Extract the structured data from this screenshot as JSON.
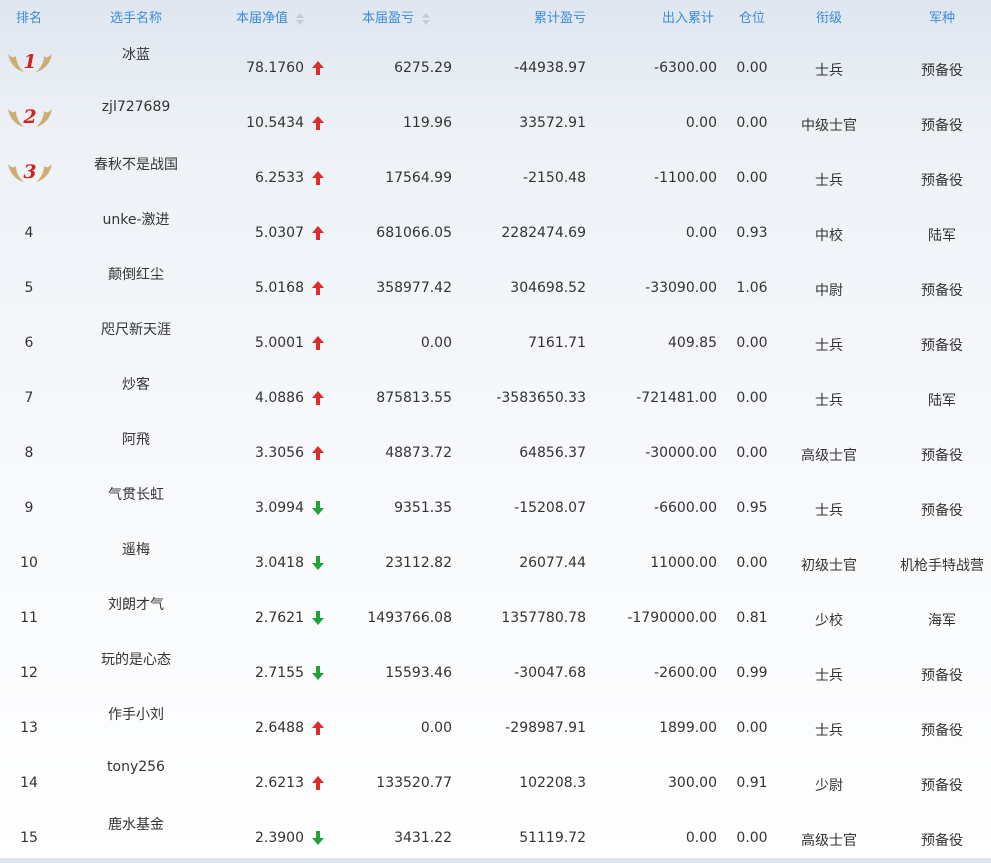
{
  "header": {
    "rank": "排名",
    "name": "选手名称",
    "nav": "本届净值",
    "profit": "本届盈亏",
    "cumulative": "累计盈亏",
    "flow": "出入累计",
    "position": "仓位",
    "grade": "衔级",
    "branch": "军种"
  },
  "colors": {
    "up": "#e02b2b",
    "down": "#22a33a",
    "header_text": "#3c8bd9",
    "medal_gold": "#c9a15a",
    "medal_red": "#d32020"
  },
  "rows": [
    {
      "rank": "1",
      "medal": true,
      "name": "冰蓝",
      "nav": "78.1760",
      "trend": "up",
      "profit": "6275.29",
      "cumulative": "-44938.97",
      "flow": "-6300.00",
      "position": "0.00",
      "grade": "士兵",
      "branch": "预备役"
    },
    {
      "rank": "2",
      "medal": true,
      "name": "zjl727689",
      "nav": "10.5434",
      "trend": "up",
      "profit": "119.96",
      "cumulative": "33572.91",
      "flow": "0.00",
      "position": "0.00",
      "grade": "中级士官",
      "branch": "预备役"
    },
    {
      "rank": "3",
      "medal": true,
      "name": "春秋不是战国",
      "nav": "6.2533",
      "trend": "up",
      "profit": "17564.99",
      "cumulative": "-2150.48",
      "flow": "-1100.00",
      "position": "0.00",
      "grade": "士兵",
      "branch": "预备役"
    },
    {
      "rank": "4",
      "medal": false,
      "name": "unke-激进",
      "nav": "5.0307",
      "trend": "up",
      "profit": "681066.05",
      "cumulative": "2282474.69",
      "flow": "0.00",
      "position": "0.93",
      "grade": "中校",
      "branch": "陆军"
    },
    {
      "rank": "5",
      "medal": false,
      "name": "颠倒红尘",
      "nav": "5.0168",
      "trend": "up",
      "profit": "358977.42",
      "cumulative": "304698.52",
      "flow": "-33090.00",
      "position": "1.06",
      "grade": "中尉",
      "branch": "预备役"
    },
    {
      "rank": "6",
      "medal": false,
      "name": "咫尺新天涯",
      "nav": "5.0001",
      "trend": "up",
      "profit": "0.00",
      "cumulative": "7161.71",
      "flow": "409.85",
      "position": "0.00",
      "grade": "士兵",
      "branch": "预备役"
    },
    {
      "rank": "7",
      "medal": false,
      "name": "炒客",
      "nav": "4.0886",
      "trend": "up",
      "profit": "875813.55",
      "cumulative": "-3583650.33",
      "flow": "-721481.00",
      "position": "0.00",
      "grade": "士兵",
      "branch": "陆军"
    },
    {
      "rank": "8",
      "medal": false,
      "name": "阿飛",
      "nav": "3.3056",
      "trend": "up",
      "profit": "48873.72",
      "cumulative": "64856.37",
      "flow": "-30000.00",
      "position": "0.00",
      "grade": "高级士官",
      "branch": "预备役"
    },
    {
      "rank": "9",
      "medal": false,
      "name": "气贯长虹",
      "nav": "3.0994",
      "trend": "down",
      "profit": "9351.35",
      "cumulative": "-15208.07",
      "flow": "-6600.00",
      "position": "0.95",
      "grade": "士兵",
      "branch": "预备役"
    },
    {
      "rank": "10",
      "medal": false,
      "name": "遥梅",
      "nav": "3.0418",
      "trend": "down",
      "profit": "23112.82",
      "cumulative": "26077.44",
      "flow": "11000.00",
      "position": "0.00",
      "grade": "初级士官",
      "branch": "机枪手特战营"
    },
    {
      "rank": "11",
      "medal": false,
      "name": "刘朗才气",
      "nav": "2.7621",
      "trend": "down",
      "profit": "1493766.08",
      "cumulative": "1357780.78",
      "flow": "-1790000.00",
      "position": "0.81",
      "grade": "少校",
      "branch": "海军"
    },
    {
      "rank": "12",
      "medal": false,
      "name": "玩的是心态",
      "nav": "2.7155",
      "trend": "down",
      "profit": "15593.46",
      "cumulative": "-30047.68",
      "flow": "-2600.00",
      "position": "0.99",
      "grade": "士兵",
      "branch": "预备役"
    },
    {
      "rank": "13",
      "medal": false,
      "name": "作手小刘",
      "nav": "2.6488",
      "trend": "up",
      "profit": "0.00",
      "cumulative": "-298987.91",
      "flow": "1899.00",
      "position": "0.00",
      "grade": "士兵",
      "branch": "预备役"
    },
    {
      "rank": "14",
      "medal": false,
      "name": "tony256",
      "nav": "2.6213",
      "trend": "up",
      "profit": "133520.77",
      "cumulative": "102208.3",
      "flow": "300.00",
      "position": "0.91",
      "grade": "少尉",
      "branch": "预备役"
    },
    {
      "rank": "15",
      "medal": false,
      "name": "鹿水基金",
      "nav": "2.3900",
      "trend": "down",
      "profit": "3431.22",
      "cumulative": "51119.72",
      "flow": "0.00",
      "position": "0.00",
      "grade": "高级士官",
      "branch": "预备役"
    }
  ]
}
